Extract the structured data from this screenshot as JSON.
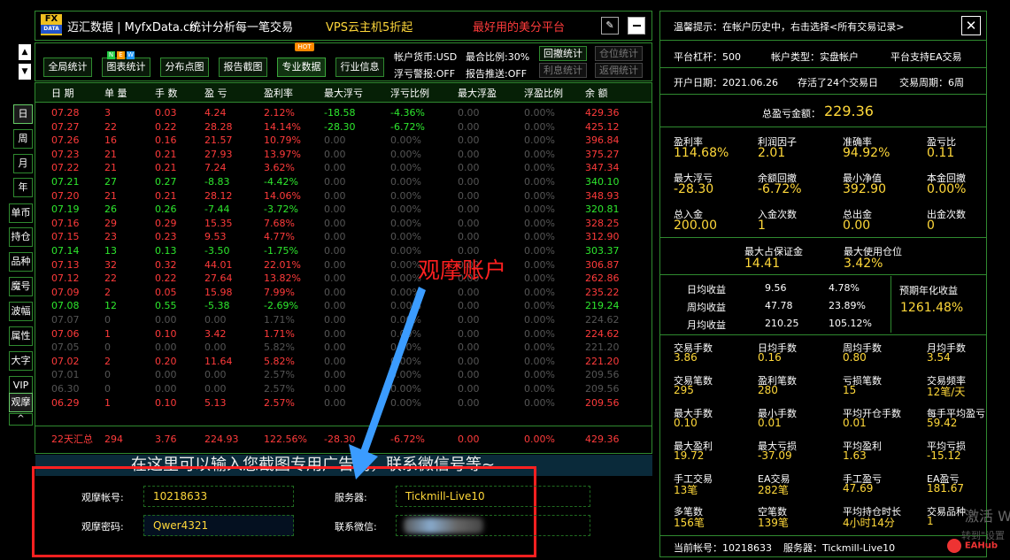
{
  "title": {
    "logo_top": "FX",
    "logo_bottom": "DATA",
    "name": "迈汇数据 | MyfxData.cn",
    "slogan": "统计分析每一笔交易",
    "promo1": "VPS云主机5折起",
    "promo2": "最好用的美分平台",
    "hot": "HOT",
    "new_letters": [
      "N",
      "E",
      "W"
    ]
  },
  "toolbar": {
    "buttons": [
      "全局统计",
      "图表统计",
      "分布点图",
      "报告截图",
      "专业数据",
      "行业信息"
    ],
    "info": [
      "帐户货币:USD",
      "最合比例:30%",
      "浮亏警报:OFF",
      "报告推送:OFF"
    ],
    "right_buttons": [
      "回撤统计",
      "仓位统计",
      "利息统计",
      "返佣统计"
    ]
  },
  "sidebar": {
    "period": [
      "日",
      "周",
      "月",
      "年"
    ],
    "tools": [
      "单币",
      "持仓",
      "品种",
      "魔号",
      "波幅",
      "属性",
      "大字",
      "VIP",
      "观摩"
    ]
  },
  "table": {
    "headers": [
      "日 期",
      "单 量",
      "手 数",
      "盈 亏",
      "盈利率",
      "最大浮亏",
      "浮亏比例",
      "最大浮盈",
      "浮盈比例",
      "余 额"
    ],
    "rows": [
      [
        "07.28",
        "3",
        "0.03",
        "4.24",
        "2.12%",
        "-18.58",
        "-4.36%",
        "0.00",
        "0.00%",
        "429.36",
        "r"
      ],
      [
        "07.27",
        "22",
        "0.22",
        "28.28",
        "14.14%",
        "-28.30",
        "-6.72%",
        "0.00",
        "0.00%",
        "425.12",
        "r"
      ],
      [
        "07.26",
        "16",
        "0.16",
        "21.57",
        "10.79%",
        "0.00",
        "0.00%",
        "0.00",
        "0.00%",
        "396.84",
        "r"
      ],
      [
        "07.23",
        "21",
        "0.21",
        "27.93",
        "13.97%",
        "0.00",
        "0.00%",
        "0.00",
        "0.00%",
        "375.27",
        "r"
      ],
      [
        "07.22",
        "21",
        "0.21",
        "7.24",
        "3.62%",
        "0.00",
        "0.00%",
        "0.00",
        "0.00%",
        "347.34",
        "r"
      ],
      [
        "07.21",
        "27",
        "0.27",
        "-8.83",
        "-4.42%",
        "0.00",
        "0.00%",
        "0.00",
        "0.00%",
        "340.10",
        "g"
      ],
      [
        "07.20",
        "21",
        "0.21",
        "28.12",
        "14.06%",
        "0.00",
        "0.00%",
        "0.00",
        "0.00%",
        "348.93",
        "r"
      ],
      [
        "07.19",
        "26",
        "0.26",
        "-7.44",
        "-3.72%",
        "0.00",
        "0.00%",
        "0.00",
        "0.00%",
        "320.81",
        "g"
      ],
      [
        "07.16",
        "29",
        "0.29",
        "15.35",
        "7.68%",
        "0.00",
        "0.00%",
        "0.00",
        "0.00%",
        "328.25",
        "r"
      ],
      [
        "07.15",
        "23",
        "0.23",
        "9.53",
        "4.77%",
        "0.00",
        "0.00%",
        "0.00",
        "0.00%",
        "312.90",
        "r"
      ],
      [
        "07.14",
        "13",
        "0.13",
        "-3.50",
        "-1.75%",
        "0.00",
        "0.00%",
        "0.00",
        "0.00%",
        "303.37",
        "g"
      ],
      [
        "07.13",
        "32",
        "0.32",
        "44.01",
        "22.01%",
        "0.00",
        "0.00%",
        "0.00",
        "0.00%",
        "306.87",
        "r"
      ],
      [
        "07.12",
        "22",
        "0.22",
        "27.64",
        "13.82%",
        "0.00",
        "0.00%",
        "0.00",
        "0.00%",
        "262.86",
        "r"
      ],
      [
        "07.09",
        "2",
        "0.05",
        "15.98",
        "7.99%",
        "0.00",
        "0.00%",
        "0.00",
        "0.00%",
        "235.22",
        "r"
      ],
      [
        "07.08",
        "12",
        "0.55",
        "-5.38",
        "-2.69%",
        "0.00",
        "0.00%",
        "0.00",
        "0.00%",
        "219.24",
        "g"
      ],
      [
        "07.07",
        "0",
        "0.00",
        "0.00",
        "1.71%",
        "0.00",
        "0.00%",
        "0.00",
        "0.00%",
        "224.62",
        "x"
      ],
      [
        "07.06",
        "1",
        "0.10",
        "3.42",
        "1.71%",
        "0.00",
        "0.00%",
        "0.00",
        "0.00%",
        "224.62",
        "r"
      ],
      [
        "07.05",
        "0",
        "0.00",
        "0.00",
        "5.82%",
        "0.00",
        "0.00%",
        "0.00",
        "0.00%",
        "221.20",
        "x"
      ],
      [
        "07.02",
        "2",
        "0.20",
        "11.64",
        "5.82%",
        "0.00",
        "0.00%",
        "0.00",
        "0.00%",
        "221.20",
        "r"
      ],
      [
        "07.01",
        "0",
        "0.00",
        "0.00",
        "2.57%",
        "0.00",
        "0.00%",
        "0.00",
        "0.00%",
        "209.56",
        "x"
      ],
      [
        "06.30",
        "0",
        "0.00",
        "0.00",
        "2.57%",
        "0.00",
        "0.00%",
        "0.00",
        "0.00%",
        "209.56",
        "x"
      ],
      [
        "06.29",
        "1",
        "0.10",
        "5.13",
        "2.57%",
        "0.00",
        "0.00%",
        "0.00",
        "0.00%",
        "209.56",
        "r"
      ]
    ],
    "summary": [
      "22天汇总",
      "294",
      "3.76",
      "224.93",
      "122.56%",
      "-28.30",
      "-6.72%",
      "0.00",
      "0.00%",
      "429.36"
    ]
  },
  "overlay": {
    "annotation": "观摩账户",
    "banner": "在这里可以输入您截图专用广告词，联系微信号等~"
  },
  "credentials": {
    "account_label": "观摩帐号:",
    "account": "10218633",
    "password_label": "观摩密码:",
    "password": "Qwer4321",
    "server_label": "服务器:",
    "server": "Tickmill-Live10",
    "wechat_label": "联系微信:"
  },
  "right": {
    "tip": "温馨提示：在帐户历史中，右击选择<所有交易记录>",
    "info": [
      "平台杠杆：500",
      "帐户类型：实盘帐户",
      "平台支持EA交易",
      "开户日期：2021.06.26",
      "存活了24个交易日",
      "交易周期：6周"
    ],
    "total_label": "总盈亏金额：",
    "total": "229.36",
    "grid1": [
      [
        "盈利率",
        "114.68%"
      ],
      [
        "利润因子",
        "2.01"
      ],
      [
        "准确率",
        "94.92%"
      ],
      [
        "盈亏比",
        "0.11"
      ],
      [
        "最大浮亏",
        "-28.30"
      ],
      [
        "余额回撤",
        "-6.72%"
      ],
      [
        "最小净值",
        "392.90"
      ],
      [
        "本金回撤",
        "0.00%"
      ],
      [
        "总入金",
        "200.00"
      ],
      [
        "入金次数",
        "1"
      ],
      [
        "总出金",
        "0.00"
      ],
      [
        "出金次数",
        "0"
      ]
    ],
    "margin": [
      [
        "最大占保证金",
        "14.41"
      ],
      [
        "最大使用仓位",
        "3.42%"
      ]
    ],
    "daily": [
      [
        "日均收益",
        "9.56",
        "4.78%"
      ],
      [
        "周均收益",
        "47.78",
        "23.89%"
      ],
      [
        "月均收益",
        "210.25",
        "105.12%"
      ]
    ],
    "annual_label": "预期年化收益",
    "annual": "1261.48%",
    "grid2": [
      [
        "交易手数",
        "3.86"
      ],
      [
        "日均手数",
        "0.16"
      ],
      [
        "周均手数",
        "0.80"
      ],
      [
        "月均手数",
        "3.54"
      ],
      [
        "交易笔数",
        "295"
      ],
      [
        "盈利笔数",
        "280"
      ],
      [
        "亏损笔数",
        "15"
      ],
      [
        "交易频率",
        "12笔/天"
      ],
      [
        "最大手数",
        "0.10"
      ],
      [
        "最小手数",
        "0.01"
      ],
      [
        "平均开仓手数",
        "0.01"
      ],
      [
        "每手平均盈亏",
        "59.42"
      ],
      [
        "最大盈利",
        "19.72"
      ],
      [
        "最大亏损",
        "-37.09"
      ],
      [
        "平均盈利",
        "1.63"
      ],
      [
        "平均亏损",
        "-15.12"
      ],
      [
        "手工交易",
        "13笔"
      ],
      [
        "EA交易",
        "282笔"
      ],
      [
        "手工盈亏",
        "47.69"
      ],
      [
        "EA盈亏",
        "181.67"
      ],
      [
        "多笔数",
        "156笔"
      ],
      [
        "空笔数",
        "139笔"
      ],
      [
        "平均持仓时长",
        "4小时14分"
      ],
      [
        "交易品种",
        "1"
      ]
    ],
    "footer": [
      "当前帐号：10218633",
      "服务器：Tickmill-Live10"
    ],
    "watermark": "激活 W",
    "watermark2": "转到\"设置",
    "eahub": "EAHub"
  },
  "colors": {
    "red": "#ff3b3b",
    "green": "#2ee82e",
    "yellow": "#ffd83a",
    "border": "#2f8a2f"
  }
}
